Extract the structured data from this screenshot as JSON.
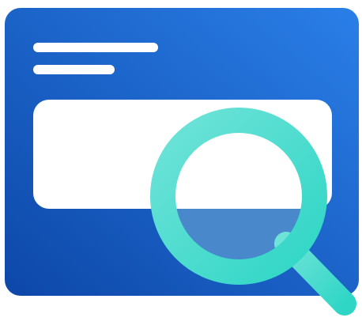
{
  "illustration": {
    "subject": "browser-search",
    "colors": {
      "window_gradient_start": "#2A7FE8",
      "window_gradient_end": "#0D47A8",
      "text_lines": "#FFFFFF",
      "content_box": "#FFFFFF",
      "lens_fill": "#4A88CC",
      "magnifier_gradient_start": "#6FE3D8",
      "magnifier_gradient_end": "#2FD6C6"
    },
    "icons": [
      "browser-window-icon",
      "magnifying-glass-icon"
    ]
  }
}
